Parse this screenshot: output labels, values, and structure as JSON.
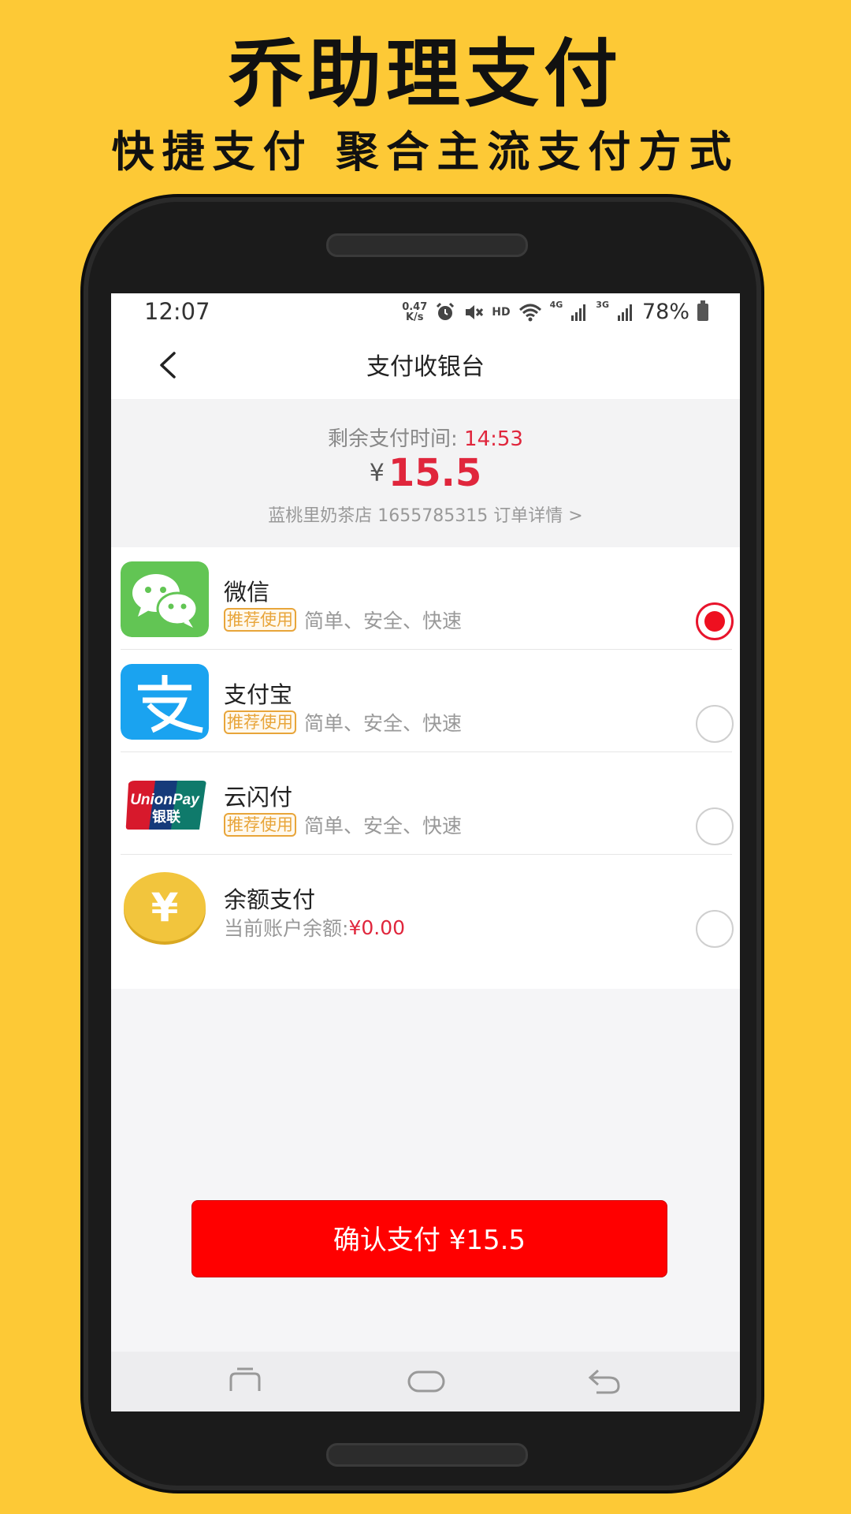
{
  "promo": {
    "title": "乔助理支付",
    "subtitle": "快捷支付 聚合主流支付方式"
  },
  "status_bar": {
    "time": "12:07",
    "speed_value": "0.47",
    "speed_unit": "K/s",
    "hd": "HD",
    "net_4g": "4G",
    "net_3g": "3G",
    "battery": "78%"
  },
  "nav": {
    "title": "支付收银台"
  },
  "summary": {
    "remaining_label": "剩余支付时间: ",
    "remaining_time": "14:53",
    "currency": "¥",
    "amount": "15.5",
    "order_info": "蓝桃里奶茶店 1655785315 订单详情 >"
  },
  "methods": [
    {
      "name": "微信",
      "tag": "推荐使用",
      "desc": "简单、安全、快速",
      "selected": true
    },
    {
      "name": "支付宝",
      "tag": "推荐使用",
      "desc": "简单、安全、快速",
      "selected": false
    },
    {
      "name": "云闪付",
      "tag": "推荐使用",
      "desc": "简单、安全、快速",
      "selected": false
    },
    {
      "name": "余额支付",
      "balance_label": "当前账户余额: ",
      "balance_value": "¥0.00",
      "selected": false
    }
  ],
  "unionpay_logo": {
    "line1": "UnionPay",
    "line2": "银联"
  },
  "balance_icon_symbol": "¥",
  "confirm_button": {
    "label": "确认支付 ¥15.5"
  },
  "colors": {
    "background": "#fdc936",
    "accent_red": "#e0263c",
    "button_red": "#ff0000",
    "tag_orange": "#e8a53a",
    "wechat_green": "#62c554",
    "alipay_blue": "#1aa3f0"
  }
}
